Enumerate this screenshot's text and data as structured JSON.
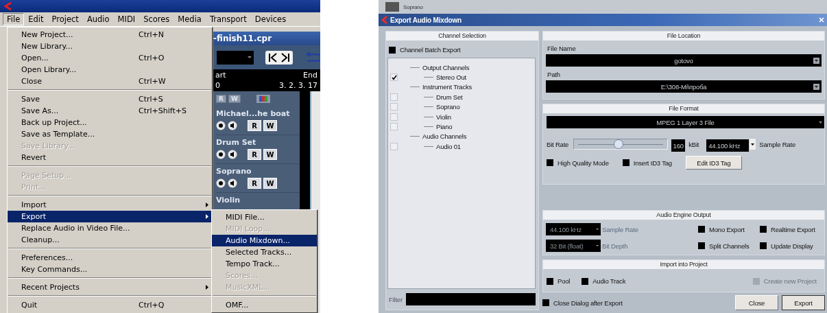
{
  "main_window": {
    "menubar": [
      {
        "label": "File",
        "selected": true
      },
      {
        "label": "Edit",
        "selected": false
      },
      {
        "label": "Project",
        "selected": false
      },
      {
        "label": "Audio",
        "selected": false
      },
      {
        "label": "MIDI",
        "selected": false
      },
      {
        "label": "Scores",
        "selected": false
      },
      {
        "label": "Media",
        "selected": false
      },
      {
        "label": "Transport",
        "selected": false
      },
      {
        "label": "Devices",
        "selected": false
      }
    ]
  },
  "file_menu": {
    "groups": [
      [
        {
          "label": "New Project...",
          "shortcut": "Ctrl+N",
          "disabled": false,
          "selected": false,
          "submenu": false
        },
        {
          "label": "New Library...",
          "disabled": false,
          "selected": false,
          "submenu": false
        },
        {
          "label": "Open...",
          "shortcut": "Ctrl+O",
          "disabled": false,
          "selected": false,
          "submenu": false
        },
        {
          "label": "Open Library...",
          "disabled": false,
          "selected": false,
          "submenu": false
        },
        {
          "label": "Close",
          "shortcut": "Ctrl+W",
          "disabled": false,
          "selected": false,
          "submenu": false
        }
      ],
      [
        {
          "label": "Save",
          "shortcut": "Ctrl+S",
          "disabled": false,
          "selected": false,
          "submenu": false
        },
        {
          "label": "Save As...",
          "shortcut": "Ctrl+Shift+S",
          "disabled": false,
          "selected": false,
          "submenu": false
        },
        {
          "label": "Back up Project...",
          "disabled": false,
          "selected": false,
          "submenu": false
        },
        {
          "label": "Save as Template...",
          "disabled": false,
          "selected": false,
          "submenu": false
        },
        {
          "label": "Save Library...",
          "disabled": true,
          "selected": false,
          "submenu": false
        },
        {
          "label": "Revert",
          "disabled": false,
          "selected": false,
          "submenu": false
        }
      ],
      [
        {
          "label": "Page Setup...",
          "disabled": true,
          "selected": false,
          "submenu": false
        },
        {
          "label": "Print...",
          "disabled": true,
          "selected": false,
          "submenu": false
        }
      ],
      [
        {
          "label": "Import",
          "disabled": false,
          "selected": false,
          "submenu": true
        },
        {
          "label": "Export",
          "disabled": false,
          "selected": true,
          "submenu": true
        },
        {
          "label": "Replace Audio in Video File...",
          "disabled": false,
          "selected": false,
          "submenu": false
        },
        {
          "label": "Cleanup...",
          "disabled": false,
          "selected": false,
          "submenu": false
        }
      ],
      [
        {
          "label": "Preferences...",
          "disabled": false,
          "selected": false,
          "submenu": false
        },
        {
          "label": "Key Commands...",
          "disabled": false,
          "selected": false,
          "submenu": false
        }
      ],
      [
        {
          "label": "Recent Projects",
          "disabled": false,
          "selected": false,
          "submenu": true
        }
      ],
      [
        {
          "label": "Quit",
          "shortcut": "Ctrl+Q",
          "disabled": false,
          "selected": false,
          "submenu": false
        }
      ]
    ]
  },
  "export_submenu": {
    "groups": [
      [
        {
          "label": "MIDI File...",
          "disabled": false,
          "selected": false,
          "submenu": false
        },
        {
          "label": "MIDI Loop...",
          "disabled": true,
          "selected": false,
          "submenu": false
        },
        {
          "label": "Audio Mixdown...",
          "disabled": false,
          "selected": true,
          "submenu": false
        },
        {
          "label": "Selected Tracks...",
          "disabled": false,
          "selected": false,
          "submenu": false
        },
        {
          "label": "Tempo Track...",
          "disabled": false,
          "selected": false,
          "submenu": false
        },
        {
          "label": "Scores...",
          "disabled": true,
          "selected": false,
          "submenu": false
        },
        {
          "label": "MusicXML...",
          "disabled": true,
          "selected": false,
          "submenu": false
        }
      ],
      [
        {
          "label": "OMF...",
          "disabled": false,
          "selected": false,
          "submenu": false
        }
      ]
    ]
  },
  "project_window": {
    "title": "-finish11.cpr",
    "start_label": "art",
    "end_label": "End",
    "start_value": "0",
    "end_value": "3. 2. 3. 17",
    "read_all": "R",
    "write_all": "W",
    "tracks": [
      {
        "name": "Michael...he boat",
        "read": "R",
        "write": "W"
      },
      {
        "name": "Drum Set",
        "read": "R",
        "write": "W"
      },
      {
        "name": "Soprano",
        "read": "R",
        "write": "W"
      },
      {
        "name": "Violin"
      }
    ]
  },
  "export_dialog": {
    "backdrop_track": "Soprano",
    "title": "Export Audio Mixdown",
    "channel_selection": {
      "heading": "Channel Selection",
      "batch_export": {
        "label": "Channel Batch Export",
        "checked": false
      },
      "tree": [
        {
          "label": "Output Channels",
          "children": [
            {
              "label": "Stereo Out",
              "checked": true
            }
          ]
        },
        {
          "label": "Instrument Tracks",
          "children": [
            {
              "label": "Drum Set",
              "checked": false
            },
            {
              "label": "Soprano",
              "checked": false
            },
            {
              "label": "Violin",
              "checked": false
            },
            {
              "label": "Piano",
              "checked": false
            }
          ]
        },
        {
          "label": "Audio Channels",
          "children": [
            {
              "label": "Audio 01",
              "checked": false
            }
          ]
        }
      ],
      "filter_label": "Filter"
    },
    "file_location": {
      "heading": "File Location",
      "file_name_label": "File Name",
      "file_name": "gotovo",
      "path_label": "Path",
      "path": "E:\\308-Mi\\проба"
    },
    "file_format": {
      "heading": "File Format",
      "format": "MPEG 1 Layer 3 File",
      "bit_rate_label": "Bit Rate",
      "bit_rate": {
        "level": 0.48
      },
      "bit_rate_value": "160",
      "bit_rate_unit": "kBit",
      "sample_rate": "44.100 kHz",
      "sample_rate_label": "Sample Rate",
      "options": [
        {
          "label": "High Quality Mode",
          "checked": false
        },
        {
          "label": "Insert ID3 Tag",
          "checked": false
        }
      ],
      "edit_tag_button": "Edit ID3 Tag"
    },
    "audio_engine_output": {
      "heading": "Audio Engine Output",
      "sample_rate": "44.100 kHz",
      "sample_rate_label": "Sample Rate",
      "bit_depth": "32 Bit (float)",
      "bit_depth_label": "Bit Depth",
      "options": [
        {
          "label": "Mono Export",
          "checked": false
        },
        {
          "label": "Realtime Export",
          "checked": false
        },
        {
          "label": "Split Channels",
          "checked": false
        },
        {
          "label": "Update Display",
          "checked": false
        }
      ]
    },
    "import_into_project": {
      "heading": "Import into Project",
      "options": [
        {
          "label": "Pool",
          "checked": false,
          "disabled": false
        },
        {
          "label": "Audio Track",
          "checked": false,
          "disabled": false
        },
        {
          "label": "Create new Project",
          "checked": false,
          "disabled": true
        }
      ]
    },
    "close_after_export": {
      "label": "Close Dialog after Export",
      "checked": false
    },
    "buttons": [
      "Close",
      "Export"
    ]
  }
}
